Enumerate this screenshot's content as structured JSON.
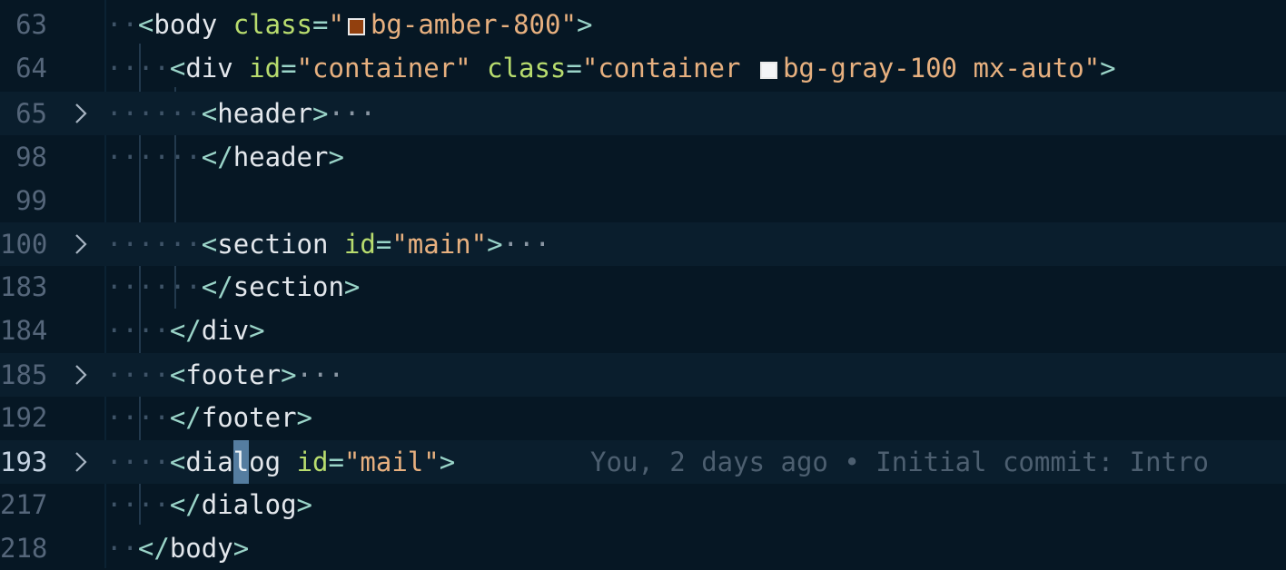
{
  "swatch_colors": {
    "amber": "#92400e",
    "gray": "#f3f4f6"
  },
  "icons": {
    "fold": "chevron-right-icon",
    "ellipsis": "ellipsis-icon"
  },
  "lines": [
    {
      "num": "63",
      "indent": "··",
      "folded": false,
      "folder": false
    },
    {
      "num": "64",
      "indent": "····",
      "folded": false,
      "folder": false
    },
    {
      "num": "65",
      "indent": "······",
      "folded": true,
      "folder": true
    },
    {
      "num": "98",
      "indent": "······",
      "folded": false,
      "folder": false
    },
    {
      "num": "99",
      "indent": "",
      "folded": false,
      "folder": false
    },
    {
      "num": "100",
      "indent": "······",
      "folded": true,
      "folder": true
    },
    {
      "num": "183",
      "indent": "······",
      "folded": false,
      "folder": false
    },
    {
      "num": "184",
      "indent": "····",
      "folded": false,
      "folder": false
    },
    {
      "num": "185",
      "indent": "····",
      "folded": true,
      "folder": true
    },
    {
      "num": "192",
      "indent": "····",
      "folded": false,
      "folder": false
    },
    {
      "num": "193",
      "indent": "····",
      "folded": true,
      "folder": true,
      "active": true
    },
    {
      "num": "217",
      "indent": "····",
      "folded": false,
      "folder": false
    },
    {
      "num": "218",
      "indent": "··",
      "folded": false,
      "folder": false
    }
  ],
  "tokens": {
    "l63_open": "<",
    "l63_tag": "body",
    "l63_attr": "class",
    "l63_eq": "=",
    "l63_q1": "\"",
    "l63_val": "bg-amber-800",
    "l63_q2": "\"",
    "l63_close": ">",
    "l64_open": "<",
    "l64_tag": "div",
    "l64_attr1": "id",
    "l64_eq1": "=",
    "l64_val1": "\"container\"",
    "l64_attr2": "class",
    "l64_eq2": "=",
    "l64_val2a": "\"container",
    "l64_val2b": "bg-gray-100 mx-auto\"",
    "l64_close": ">",
    "l65_open": "<",
    "l65_tag": "header",
    "l65_close": ">",
    "l65_dots": "···",
    "l98_open": "</",
    "l98_tag": "header",
    "l98_close": ">",
    "l100_open": "<",
    "l100_tag": "section",
    "l100_attr": "id",
    "l100_eq": "=",
    "l100_val": "\"main\"",
    "l100_close": ">",
    "l100_dots": "···",
    "l183_open": "</",
    "l183_tag": "section",
    "l183_close": ">",
    "l184_open": "</",
    "l184_tag": "div",
    "l184_close": ">",
    "l185_open": "<",
    "l185_tag": "footer",
    "l185_close": ">",
    "l185_dots": "···",
    "l192_open": "</",
    "l192_tag": "footer",
    "l192_close": ">",
    "l193_open": "<",
    "l193_tag_a": "dia",
    "l193_tag_cursor": "l",
    "l193_tag_b": "og",
    "l193_attr": "id",
    "l193_eq": "=",
    "l193_val": "\"mail\"",
    "l193_close": ">",
    "l217_open": "</",
    "l217_tag": "dialog",
    "l217_close": ">",
    "l218_open": "</",
    "l218_tag": "body",
    "l218_close": ">"
  },
  "blame": "You, 2 days ago • Initial commit: Intro"
}
